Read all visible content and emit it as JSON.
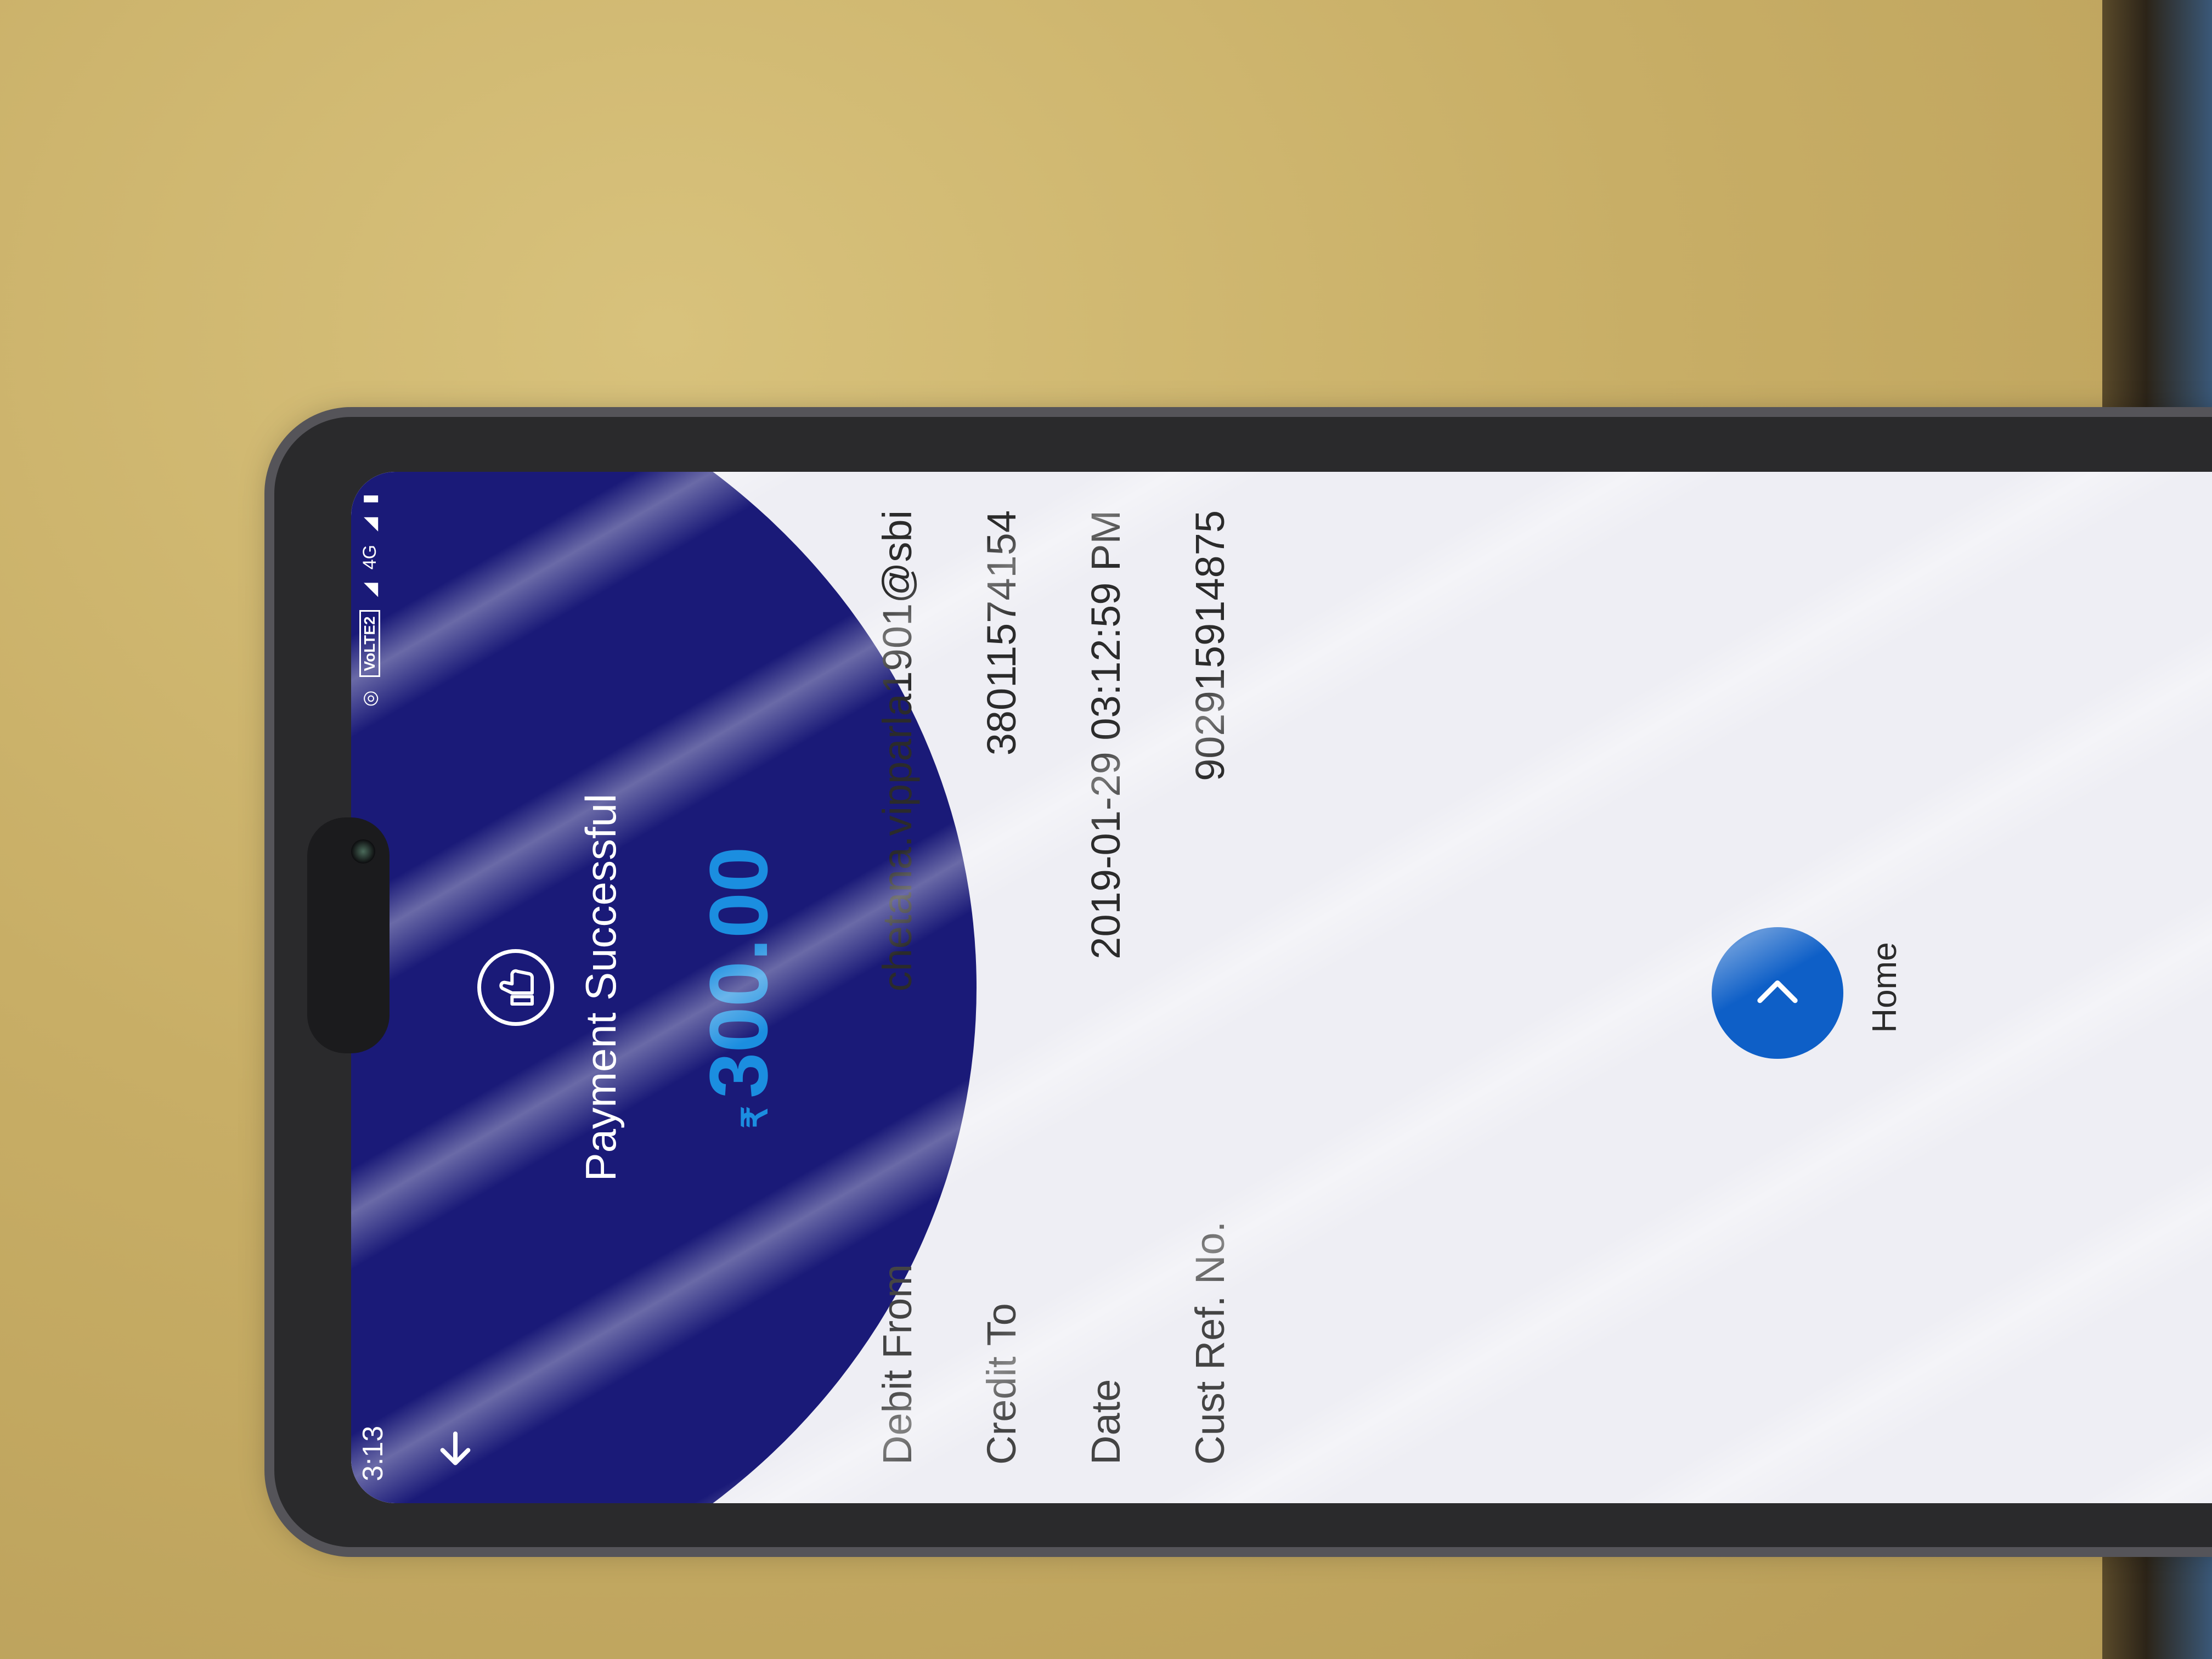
{
  "status_bar": {
    "time": "3:13",
    "network_badge": "VoLTE2",
    "network_type": "4G"
  },
  "header": {
    "back_icon": "arrow-left-icon",
    "status_icon": "thumbs-up-icon",
    "title": "Payment Successful"
  },
  "amount": {
    "currency_symbol": "₹",
    "value": "300.00"
  },
  "details": [
    {
      "label": "Debit From",
      "value": "chetana.vipparla1901@sbi"
    },
    {
      "label": "Credit To",
      "value": "38011574154"
    },
    {
      "label": "Date",
      "value": "2019-01-29 03:12:59 PM"
    },
    {
      "label": "Cust Ref. No.",
      "value": "902915914875"
    }
  ],
  "home": {
    "icon": "chevron-right-icon",
    "label": "Home"
  },
  "colors": {
    "header_bg": "#1a1a78",
    "amount": "#1b8ee0",
    "home_button": "#0e5fc7",
    "screen_bg": "#eeeef4"
  }
}
